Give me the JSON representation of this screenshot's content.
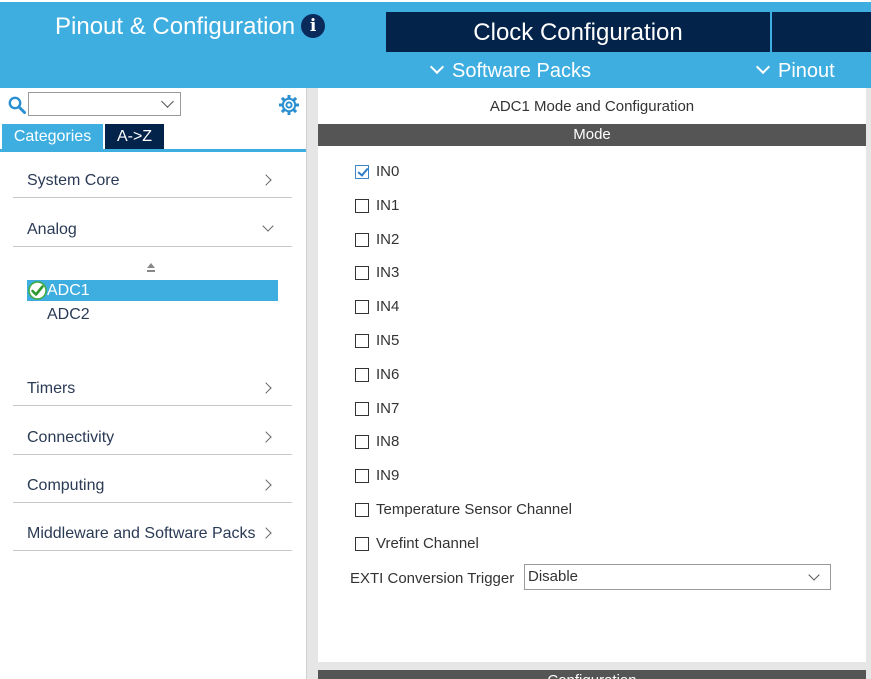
{
  "tabs": {
    "pinout_config": "Pinout & Configuration",
    "clock_config": "Clock Configuration"
  },
  "menus": {
    "software_packs": "Software Packs",
    "pinout": "Pinout"
  },
  "left_panel": {
    "search_value": "",
    "view_tabs": [
      "Categories",
      "A->Z"
    ],
    "categories": {
      "system_core": "System Core",
      "analog": "Analog",
      "timers": "Timers",
      "connectivity": "Connectivity",
      "computing": "Computing",
      "middleware": "Middleware and Software Packs"
    },
    "analog_items": [
      "ADC1",
      "ADC2"
    ],
    "selected_item": "ADC1"
  },
  "right_panel": {
    "title": "ADC1 Mode and Configuration",
    "mode_header": "Mode",
    "channels": [
      {
        "label": "IN0",
        "checked": true
      },
      {
        "label": "IN1",
        "checked": false
      },
      {
        "label": "IN2",
        "checked": false
      },
      {
        "label": "IN3",
        "checked": false
      },
      {
        "label": "IN4",
        "checked": false
      },
      {
        "label": "IN5",
        "checked": false
      },
      {
        "label": "IN6",
        "checked": false
      },
      {
        "label": "IN7",
        "checked": false
      },
      {
        "label": "IN8",
        "checked": false
      },
      {
        "label": "IN9",
        "checked": false
      },
      {
        "label": "Temperature Sensor Channel",
        "checked": false
      },
      {
        "label": "Vrefint Channel",
        "checked": false
      }
    ],
    "exti_label": "EXTI Conversion Trigger",
    "exti_value": "Disable",
    "config_header": "Configuration"
  },
  "colors": {
    "accent": "#3eaee0",
    "dark_navy": "#03234b",
    "section_header": "#555555"
  }
}
